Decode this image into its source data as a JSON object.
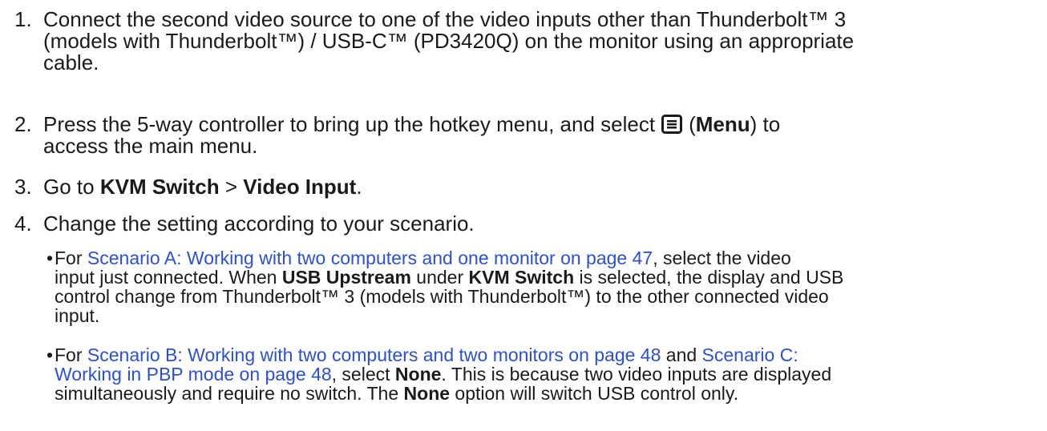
{
  "steps": [
    {
      "num": "1.",
      "line1": "Connect the second video source to one of the video inputs other than Thunderbolt™ 3",
      "line2": "(models with Thunderbolt™) / USB-C™ (PD3420Q) on the monitor using an appropriate",
      "line3": "cable."
    },
    {
      "num": "2.",
      "t1": "Press the 5-way controller to bring up the hotkey menu, and select",
      "icon": "menu-icon",
      "t2": "(",
      "bold1": "Menu",
      "t3": ") to",
      "line2": "access the main menu."
    },
    {
      "num": "3.",
      "t1": "Go to ",
      "bold1": "KVM Switch",
      "t2": " > ",
      "bold2": "Video Input",
      "t3": "."
    },
    {
      "num": "4.",
      "text": "Change the setting according to your scenario."
    }
  ],
  "bullets": [
    {
      "dot": "•",
      "pre": "For ",
      "link": "Scenario A: Working with two computers and one monitor on page 47",
      "l1rest": ", select the video",
      "l2a": "input just connected. When ",
      "l2b1": "USB Upstream",
      "l2c": " under ",
      "l2b2": "KVM Switch",
      "l2d": " is selected, the display and USB",
      "line3": "control change from Thunderbolt™ 3 (models with Thunderbolt™) to the other connected video",
      "line4": "input."
    },
    {
      "dot": "•",
      "pre": "For ",
      "link1": "Scenario B: Working with two computers and two monitors on page 48",
      "mid": " and ",
      "link2a": "Scenario C:",
      "link2b": "Working in PBP mode on page 48",
      "l2a": ", select ",
      "l2b": "None",
      "l2c": ". This is because two video inputs are displayed",
      "l3a": "simultaneously and require no switch. The ",
      "l3b": "None",
      "l3c": " option will switch USB control only."
    }
  ]
}
